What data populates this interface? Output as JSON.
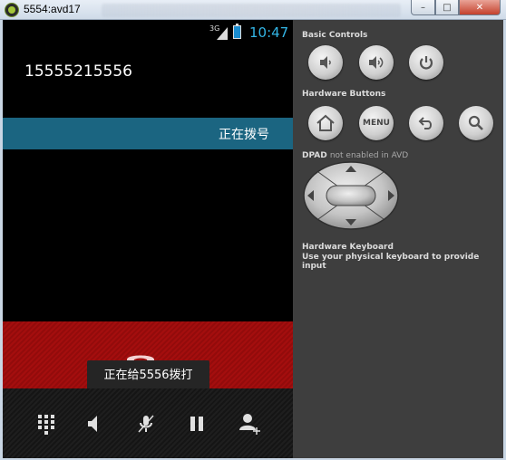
{
  "window": {
    "title": "5554:avd17",
    "minimize": "–",
    "maximize": "□",
    "close": "✕"
  },
  "status_bar": {
    "network": "3G",
    "time": "10:47"
  },
  "call": {
    "number": "15555215556",
    "status": "正在拨号",
    "toast": "正在给5556拨打"
  },
  "call_actions": [
    "dialpad-icon",
    "speaker-icon",
    "mute-icon",
    "hold-icon",
    "add-call-icon"
  ],
  "controls": {
    "basic_controls_title": "Basic Controls",
    "hardware_buttons_title": "Hardware Buttons",
    "menu_label": "MENU",
    "dpad_title": "DPAD",
    "dpad_note": "not enabled in AVD",
    "keyboard_title": "Hardware Keyboard",
    "keyboard_note": "Use your physical keyboard to provide input"
  },
  "colors": {
    "dial_bar": "#1b6581",
    "end_call": "#a40e0e",
    "clock": "#33b5e5"
  }
}
